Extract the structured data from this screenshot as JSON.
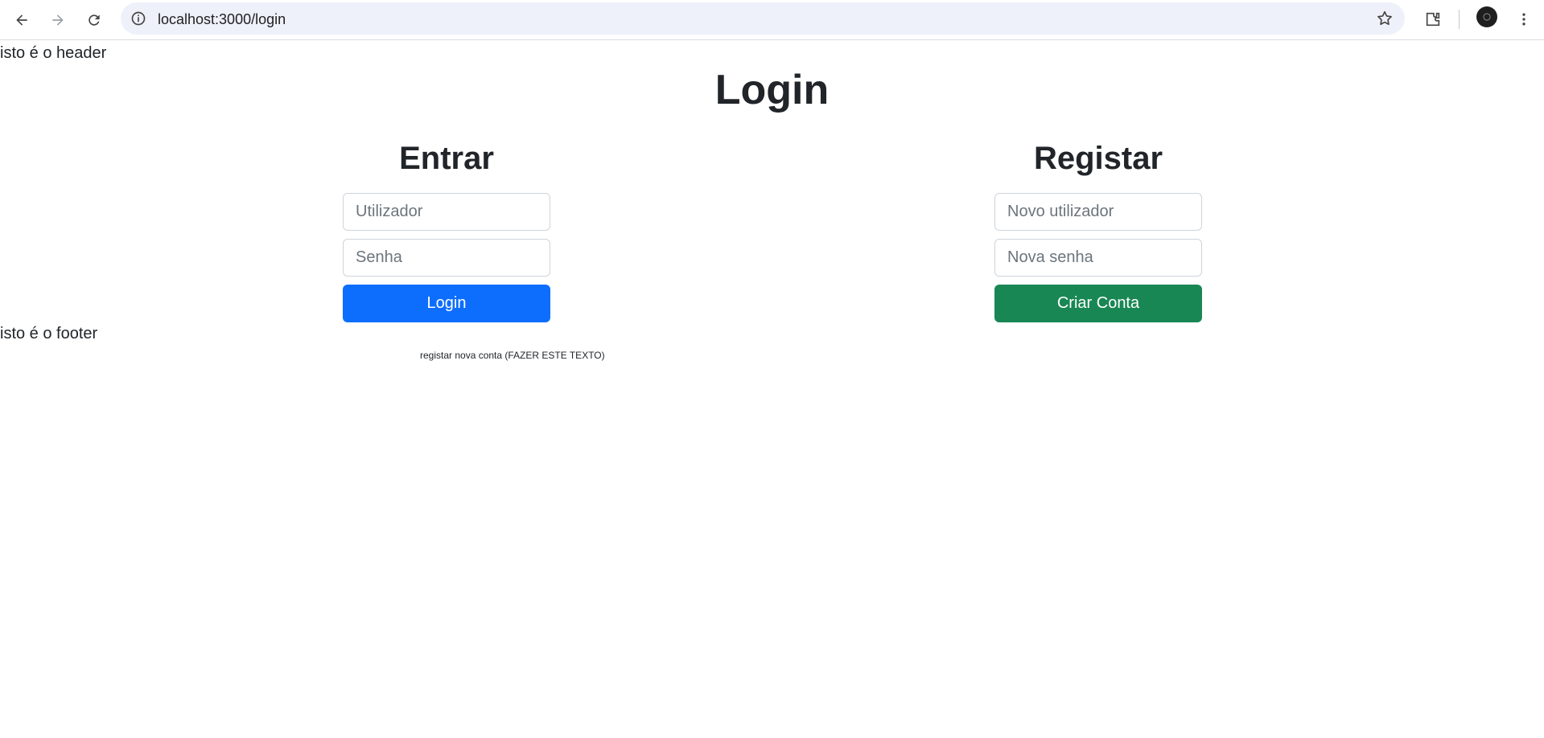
{
  "browser": {
    "url": "localhost:3000/login",
    "icons": [
      "back-arrow-icon",
      "forward-arrow-icon",
      "reload-icon",
      "site-info-icon",
      "bookmark-star-icon",
      "extensions-icon",
      "profile-avatar-icon",
      "more-menu-icon"
    ]
  },
  "page": {
    "header_text": "isto é o header",
    "title": "Login",
    "footer_text": "isto é o footer",
    "register_link_text": "registar nova conta (FAZER ESTE TEXTO)"
  },
  "login_form": {
    "heading": "Entrar",
    "username_placeholder": "Utilizador",
    "password_placeholder": "Senha",
    "submit_label": "Login",
    "submit_color": "#0d6efd"
  },
  "register_form": {
    "heading": "Registar",
    "username_placeholder": "Novo utilizador",
    "password_placeholder": "Nova senha",
    "submit_label": "Criar Conta",
    "submit_color": "#198754"
  }
}
